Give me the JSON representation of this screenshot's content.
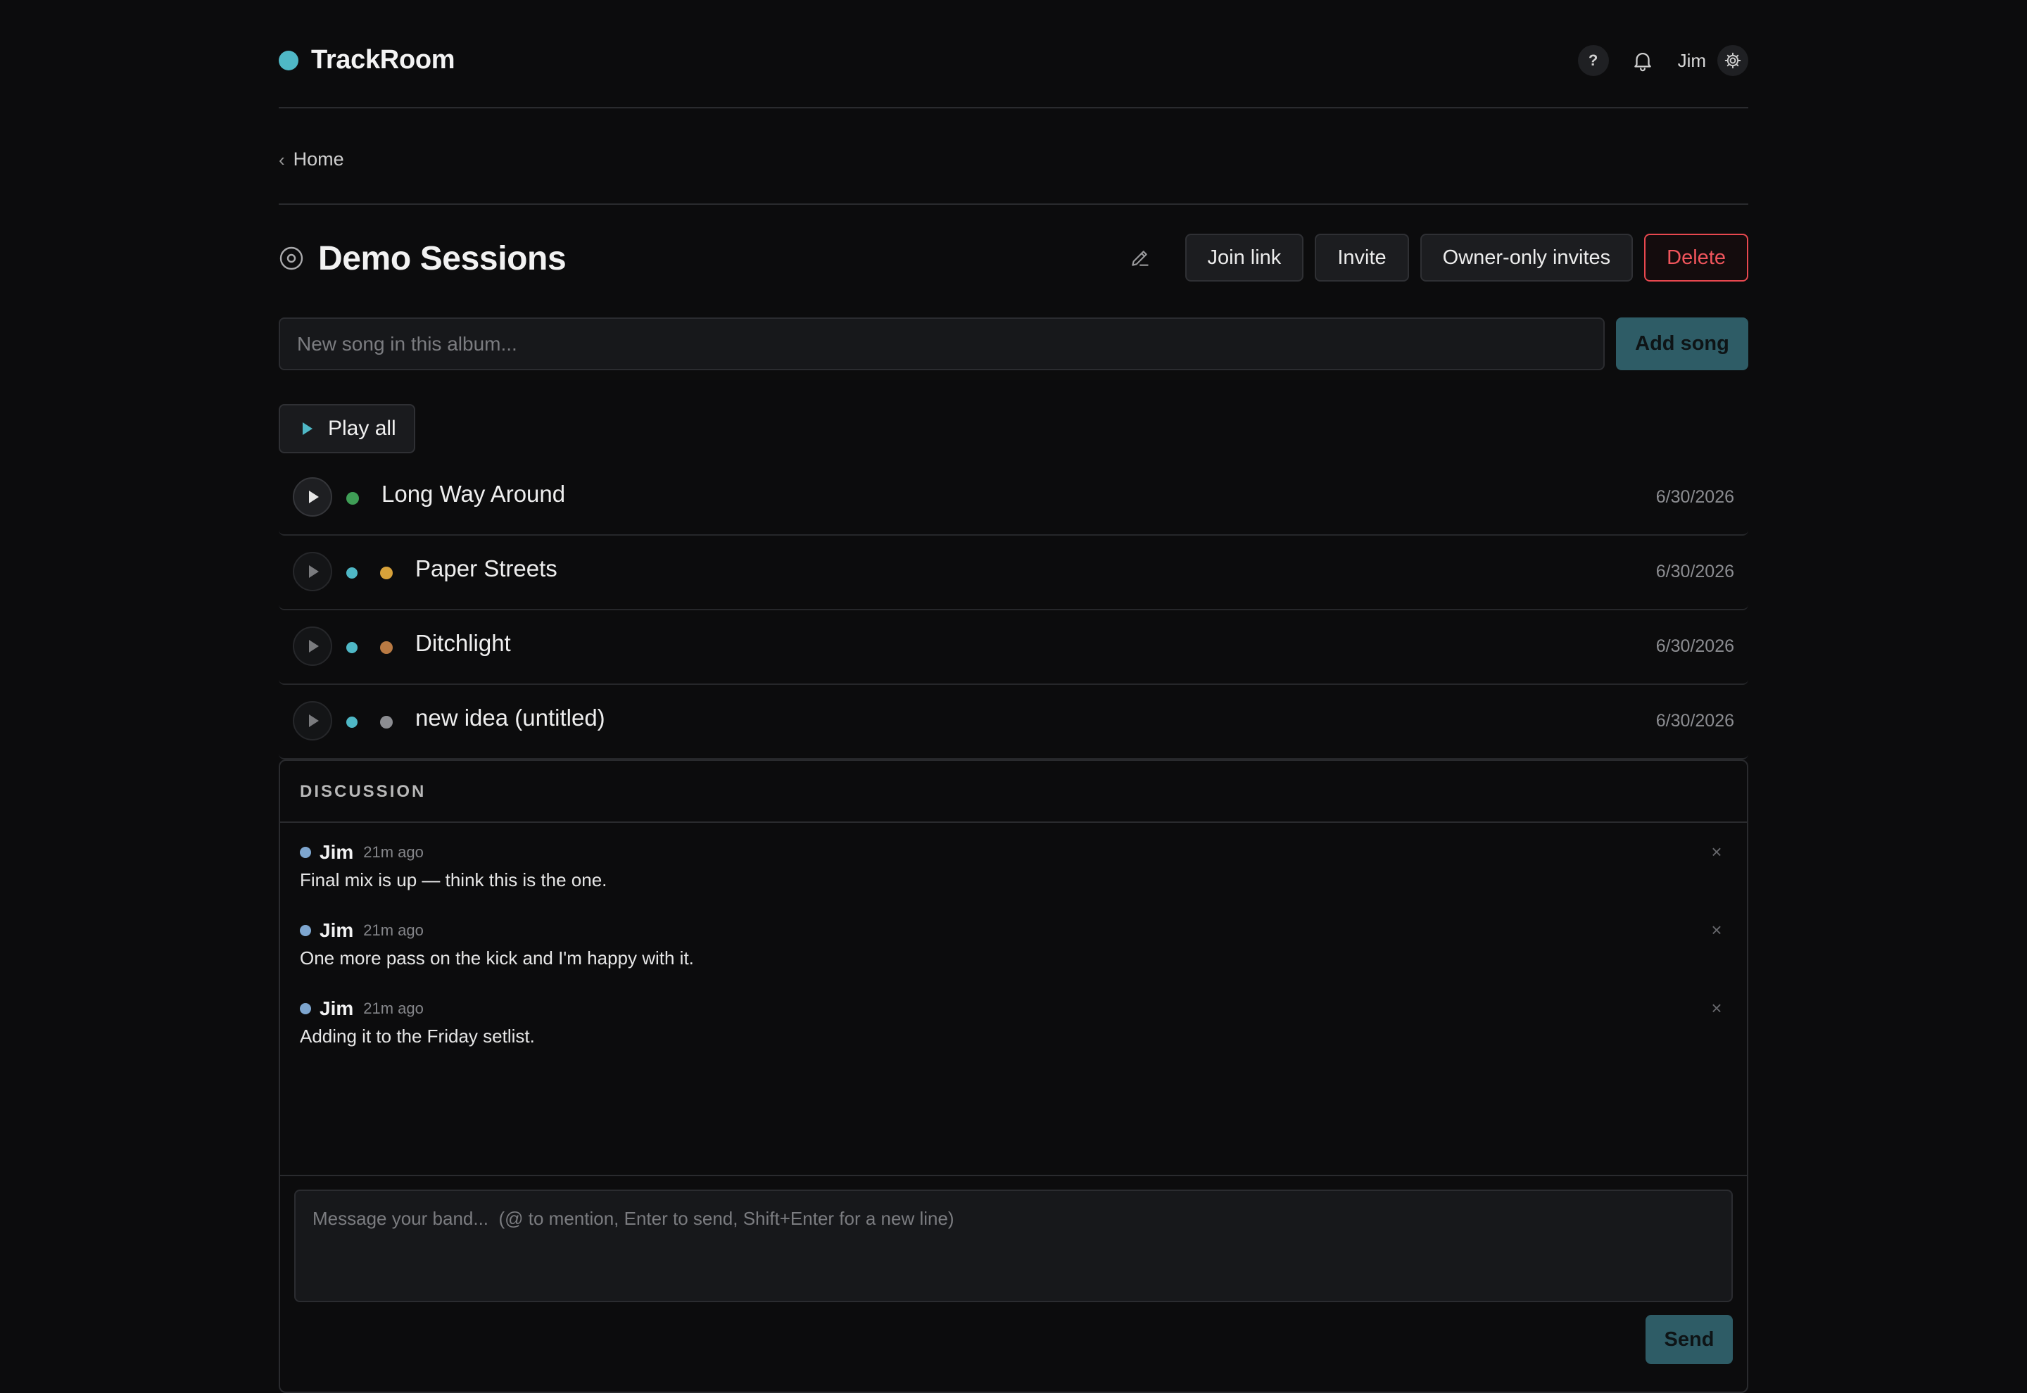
{
  "app": {
    "name": "TrackRoom",
    "brand_color": "#4fb8c6"
  },
  "header": {
    "help_label": "?",
    "user_name": "Jim"
  },
  "breadcrumb": {
    "label": "Home"
  },
  "album": {
    "title": "Demo Sessions",
    "actions": {
      "join_link": "Join link",
      "invite": "Invite",
      "owner_only": "Owner-only invites",
      "delete": "Delete"
    }
  },
  "new_song": {
    "placeholder": "New song in this album...",
    "value": "",
    "button": "Add song"
  },
  "play_all": "Play all",
  "songs": [
    {
      "title": "Long Way Around",
      "date": "6/30/2026",
      "dots": [
        "#3f9e56"
      ],
      "active": true
    },
    {
      "title": "Paper Streets",
      "date": "6/30/2026",
      "dots": [
        "#4fb8c6",
        "#d8a23a"
      ],
      "active": false
    },
    {
      "title": "Ditchlight",
      "date": "6/30/2026",
      "dots": [
        "#4fb8c6",
        "#b97a43"
      ],
      "active": false
    },
    {
      "title": "new idea (untitled)",
      "date": "6/30/2026",
      "dots": [
        "#4fb8c6",
        "#8c8d91"
      ],
      "active": false
    }
  ],
  "discussion": {
    "label": "DISCUSSION",
    "messages": [
      {
        "author": "Jim",
        "time": "21m ago",
        "body": "Final mix is up — think this is the one."
      },
      {
        "author": "Jim",
        "time": "21m ago",
        "body": "One more pass on the kick and I'm happy with it."
      },
      {
        "author": "Jim",
        "time": "21m ago",
        "body": "Adding it to the Friday setlist."
      }
    ],
    "composer_placeholder": "Message your band...  (@ to mention, Enter to send, Shift+Enter for a new line)",
    "send_label": "Send"
  },
  "icons": {
    "help": "question-icon",
    "notifications": "bell-icon",
    "settings": "gear-icon",
    "back": "chevron-left-icon",
    "album": "disc-icon",
    "edit": "pencil-icon",
    "play": "play-icon",
    "close": "close-icon"
  }
}
